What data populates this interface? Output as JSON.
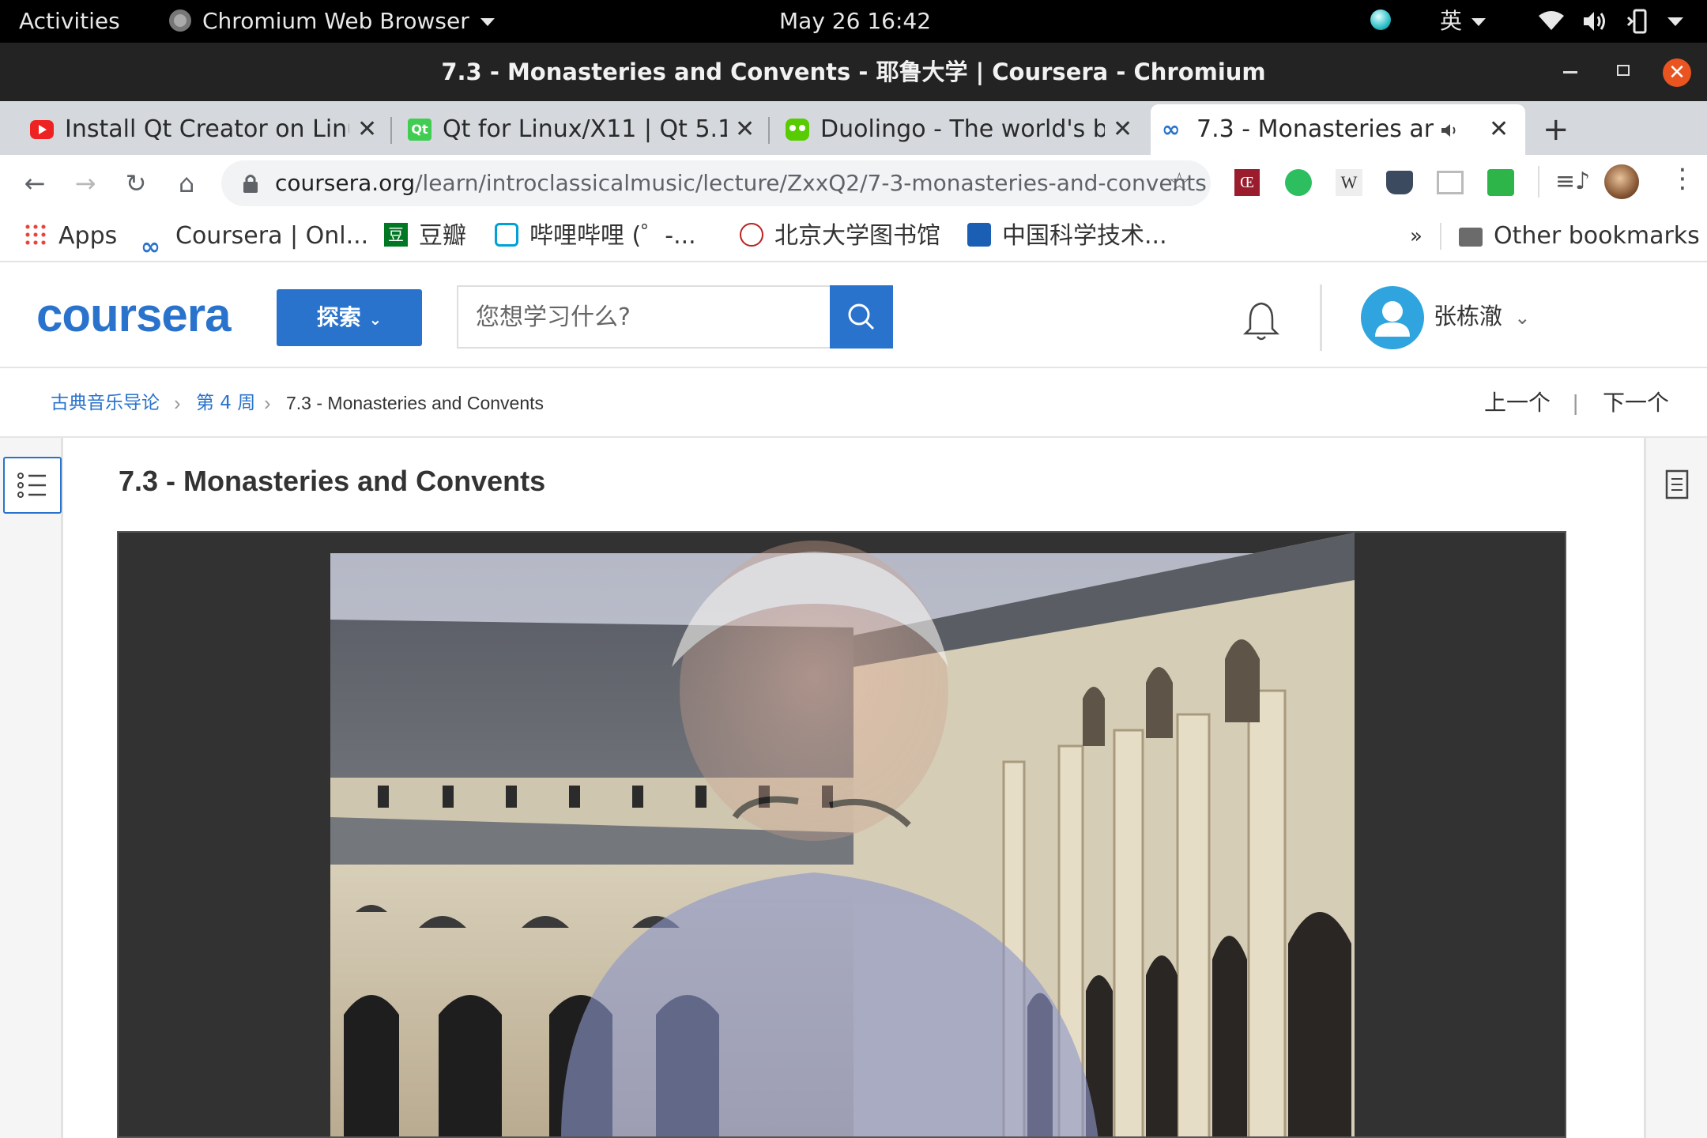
{
  "system_bar": {
    "activities": "Activities",
    "app_menu": "Chromium Web Browser",
    "clock": "May 26  16:42",
    "input_method": "英"
  },
  "window": {
    "title": "7.3 - Monasteries and Convents - 耶鲁大学 | Coursera - Chromium"
  },
  "tabs": [
    {
      "label": "Install Qt Creator on Linux",
      "icon": "youtube-icon"
    },
    {
      "label": "Qt for Linux/X11 | Qt 5.14",
      "icon": "qt-icon"
    },
    {
      "label": "Duolingo - The world's best",
      "icon": "duolingo-icon"
    },
    {
      "label": "7.3 - Monasteries and Convents",
      "icon": "coursera-icon",
      "active": true
    }
  ],
  "omnibox": {
    "host": "coursera.org",
    "path": "/learn/introclassicalmusic/lecture/ZxxQ2/7-3-monasteries-and-convents"
  },
  "bookmarks": {
    "items": [
      "Apps",
      "Coursera | Onl...",
      "豆瓣",
      "哔哩哔哩 (゜-...",
      "北京大学图书馆",
      "中国科学技术..."
    ],
    "overflow": "»",
    "other": "Other bookmarks"
  },
  "coursera": {
    "logo": "coursera",
    "explore": "探索",
    "search_placeholder": "您想学习什么?",
    "username": "张栋澈"
  },
  "breadcrumb": {
    "course": "古典音乐导论",
    "week": "第 4 周",
    "lecture": "7.3 - Monasteries and Convents",
    "prev": "上一个",
    "divider": "|",
    "next": "下一个"
  },
  "lecture": {
    "title": "7.3 - Monasteries and Convents"
  },
  "colors": {
    "coursera_blue": "#2a73cc",
    "avatar_blue": "#2fa4de",
    "close_red": "#e95420"
  }
}
